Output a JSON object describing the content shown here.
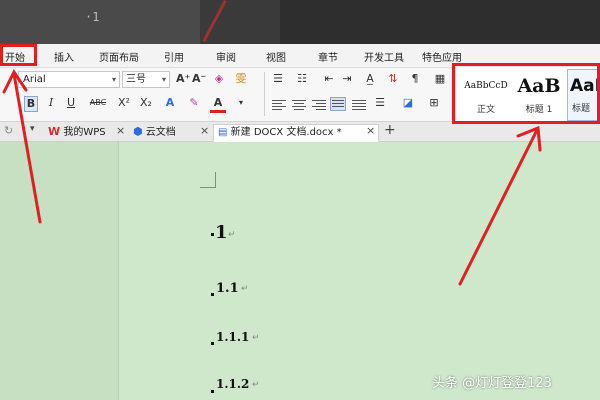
{
  "menu": {
    "items": [
      "开始",
      "插入",
      "页面布局",
      "引用",
      "审阅",
      "视图",
      "章节",
      "开发工具",
      "特色应用"
    ]
  },
  "ribbon": {
    "font_name": "Arial",
    "font_size": "三号",
    "bold": "B",
    "italic": "I",
    "underline": "U",
    "strike": "ABC",
    "superscript": "X²",
    "subscript": "X₂",
    "font_color": "A",
    "grow_font": "A⁺",
    "shrink_font": "A⁻",
    "phonetic": "雯"
  },
  "styles": [
    {
      "sample": "AaBbCcD",
      "name": "正文"
    },
    {
      "sample": "AaB",
      "name": "标题 1"
    },
    {
      "sample": "AaB",
      "name": "标题"
    }
  ],
  "tabs": [
    {
      "label": "我的WPS",
      "icon": "wps-logo-icon"
    },
    {
      "label": "云文档",
      "icon": "cloud-doc-icon"
    },
    {
      "label": "新建 DOCX 文档.docx *",
      "icon": "doc-icon",
      "active": true
    }
  ],
  "document": {
    "headings": [
      "1",
      "1.1",
      "1.1.1",
      "1.1.2"
    ]
  },
  "watermark": "头条 @灯灯登登123",
  "colors": {
    "annotation": "#e02020",
    "doc_bg": "#cfe8cc",
    "accent_blue": "#2b6ed6"
  }
}
